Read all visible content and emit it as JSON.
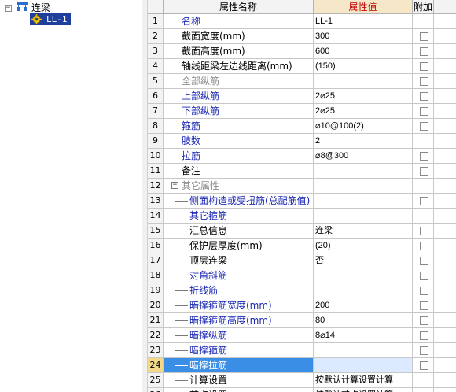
{
  "tree": {
    "root_label": "连梁",
    "child_label": "LL-1"
  },
  "grid": {
    "headers": {
      "index": "",
      "name": "属性名称",
      "value": "属性值",
      "attach": "附加"
    },
    "rows": [
      {
        "no": "1",
        "name": "名称",
        "value": "LL-1",
        "color": "blue",
        "indent": 0,
        "checkbox": false
      },
      {
        "no": "2",
        "name": "截面宽度(mm)",
        "value": "300",
        "color": "black",
        "indent": 0,
        "checkbox": true
      },
      {
        "no": "3",
        "name": "截面高度(mm)",
        "value": "600",
        "color": "black",
        "indent": 0,
        "checkbox": true
      },
      {
        "no": "4",
        "name": "轴线距梁左边线距离(mm)",
        "value": "(150)",
        "color": "black",
        "indent": 0,
        "checkbox": true
      },
      {
        "no": "5",
        "name": "全部纵筋",
        "value": "",
        "color": "grey",
        "indent": 0,
        "checkbox": true
      },
      {
        "no": "6",
        "name": "上部纵筋",
        "value": "2⌀25",
        "color": "blue",
        "indent": 0,
        "checkbox": true
      },
      {
        "no": "7",
        "name": "下部纵筋",
        "value": "2⌀25",
        "color": "blue",
        "indent": 0,
        "checkbox": true
      },
      {
        "no": "8",
        "name": "箍筋",
        "value": "⌀10@100(2)",
        "color": "blue",
        "indent": 0,
        "checkbox": true
      },
      {
        "no": "9",
        "name": "肢数",
        "value": "2",
        "color": "blue",
        "indent": 0,
        "checkbox": false
      },
      {
        "no": "10",
        "name": "拉筋",
        "value": "⌀8@300",
        "color": "blue",
        "indent": 0,
        "checkbox": true
      },
      {
        "no": "11",
        "name": "备注",
        "value": "",
        "color": "black",
        "indent": 0,
        "checkbox": true
      },
      {
        "no": "12",
        "name": "其它属性",
        "value": "",
        "color": "grey",
        "indent": 0,
        "group": true,
        "checkbox": false
      },
      {
        "no": "13",
        "name": "侧面构造或受扭筋(总配筋值)",
        "value": "",
        "color": "blue",
        "indent": 1,
        "checkbox": true
      },
      {
        "no": "14",
        "name": "其它箍筋",
        "value": "",
        "color": "blue",
        "indent": 1,
        "checkbox": false
      },
      {
        "no": "15",
        "name": "汇总信息",
        "value": "连梁",
        "color": "black",
        "indent": 1,
        "checkbox": true
      },
      {
        "no": "16",
        "name": "保护层厚度(mm)",
        "value": "(20)",
        "color": "black",
        "indent": 1,
        "checkbox": true
      },
      {
        "no": "17",
        "name": "顶层连梁",
        "value": "否",
        "color": "black",
        "indent": 1,
        "checkbox": true
      },
      {
        "no": "18",
        "name": "对角斜筋",
        "value": "",
        "color": "blue",
        "indent": 1,
        "checkbox": true
      },
      {
        "no": "19",
        "name": "折线筋",
        "value": "",
        "color": "blue",
        "indent": 1,
        "checkbox": true
      },
      {
        "no": "20",
        "name": "暗撑箍筋宽度(mm)",
        "value": "200",
        "color": "blue",
        "indent": 1,
        "checkbox": true
      },
      {
        "no": "21",
        "name": "暗撑箍筋高度(mm)",
        "value": "80",
        "color": "blue",
        "indent": 1,
        "checkbox": true
      },
      {
        "no": "22",
        "name": "暗撑纵筋",
        "value": "8⌀14",
        "color": "blue",
        "indent": 1,
        "checkbox": true
      },
      {
        "no": "23",
        "name": "暗撑箍筋",
        "value": "",
        "color": "blue",
        "indent": 1,
        "checkbox": true
      },
      {
        "no": "24",
        "name": "暗撑拉筋",
        "value": "",
        "color": "blue",
        "indent": 1,
        "checkbox": true,
        "selected": true
      },
      {
        "no": "25",
        "name": "计算设置",
        "value": "按默认计算设置计算",
        "color": "black",
        "indent": 1,
        "checkbox": false
      },
      {
        "no": "26",
        "name": "节点设置",
        "value": "按默认节点设置计算",
        "color": "black",
        "indent": 1,
        "checkbox": false
      }
    ]
  },
  "colors": {
    "selection": "#1e3f9c",
    "row_highlight": "#3b8ee6",
    "value_header_bg": "#f6e7c9",
    "value_header_text": "#c00000",
    "blue_text": "#1a27b3",
    "grey_text": "#8a8a8a"
  },
  "icons": {
    "root": "tree-structure-icon",
    "child": "gear-component-icon",
    "group": "collapse-minus-icon"
  }
}
